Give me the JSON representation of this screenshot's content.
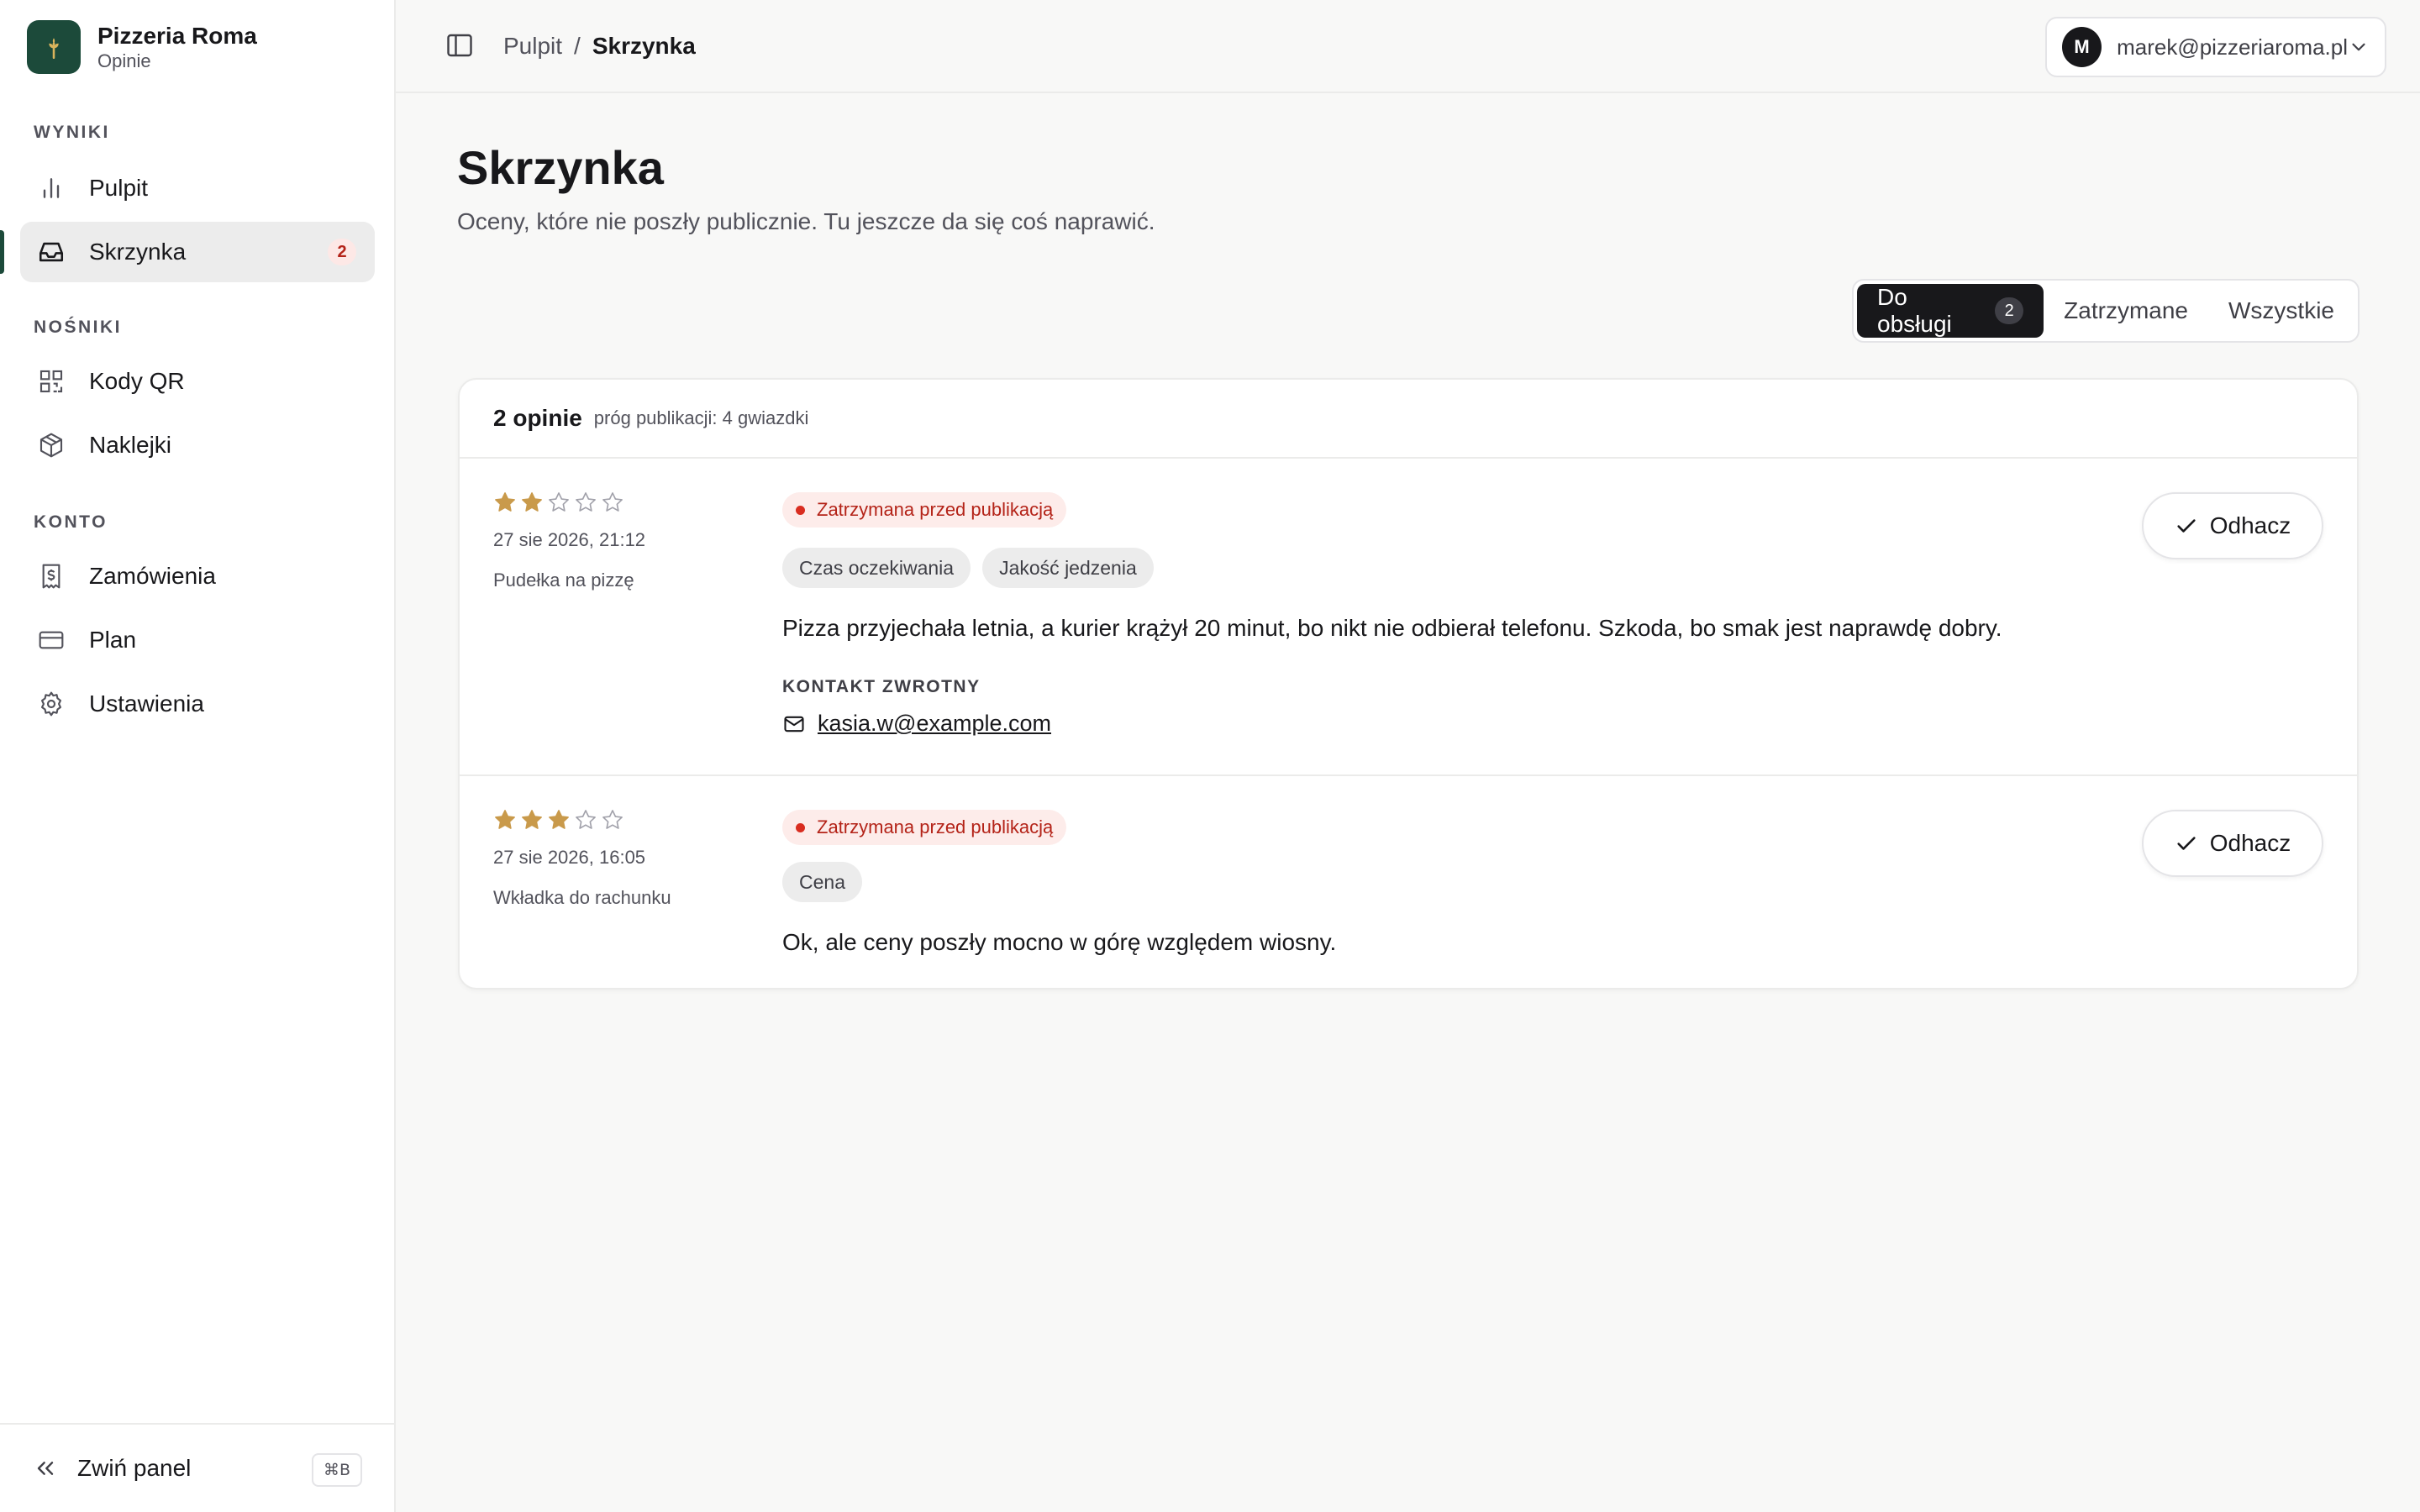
{
  "sidebar": {
    "brand": {
      "name": "Pizzeria Roma",
      "subtitle": "Opinie"
    },
    "sections": [
      {
        "label": "WYNIKI"
      },
      {
        "label": "NOŚNIKI"
      },
      {
        "label": "KONTO"
      }
    ],
    "items": [
      {
        "label": "Pulpit",
        "icon": "bar-chart-icon"
      },
      {
        "label": "Skrzynka",
        "icon": "inbox-icon",
        "badge": "2",
        "active": true
      },
      {
        "label": "Kody QR",
        "icon": "qr-code-icon"
      },
      {
        "label": "Naklejki",
        "icon": "package-icon"
      },
      {
        "label": "Zamówienia",
        "icon": "receipt-icon"
      },
      {
        "label": "Plan",
        "icon": "credit-card-icon"
      },
      {
        "label": "Ustawienia",
        "icon": "gear-icon"
      }
    ],
    "footer": {
      "collapse_label": "Zwiń panel",
      "shortcut": "⌘B"
    }
  },
  "topbar": {
    "breadcrumb": {
      "parent": "Pulpit",
      "separator": "/",
      "current": "Skrzynka"
    },
    "user": {
      "initial": "M",
      "email": "marek@pizzeriaroma.pl"
    }
  },
  "main": {
    "title": "Skrzynka",
    "subtitle": "Oceny, które nie poszły publicznie. Tu jeszcze da się coś naprawić.",
    "tabs": [
      {
        "label": "Do obsługi",
        "count": "2",
        "active": true
      },
      {
        "label": "Zatrzymane"
      },
      {
        "label": "Wszystkie"
      }
    ],
    "card": {
      "count_label": "2 opinie",
      "threshold_label": "próg publikacji: 4 gwiazdki",
      "reviews": [
        {
          "rating": 2,
          "max_rating": 5,
          "date": "27 sie 2026, 21:12",
          "source": "Pudełka na pizzę",
          "status": "Zatrzymana przed publikacją",
          "tags": [
            "Czas oczekiwania",
            "Jakość jedzenia"
          ],
          "text": "Pizza przyjechała letnia, a kurier krążył 20 minut, bo nikt nie odbierał telefonu. Szkoda, bo smak jest naprawdę dobry.",
          "contact_label": "KONTAKT ZWROTNY",
          "contact_email": "kasia.w@example.com",
          "action_label": "Odhacz"
        },
        {
          "rating": 3,
          "max_rating": 5,
          "date": "27 sie 2026, 16:05",
          "source": "Wkładka do rachunku",
          "status": "Zatrzymana przed publikacją",
          "tags": [
            "Cena"
          ],
          "text": "Ok, ale ceny poszły mocno w górę względem wiosny.",
          "action_label": "Odhacz"
        }
      ]
    }
  },
  "colors": {
    "brand": "#1c4a3a",
    "star": "#c99a4b",
    "status": "#b42318",
    "accent_dark": "#18181b"
  }
}
